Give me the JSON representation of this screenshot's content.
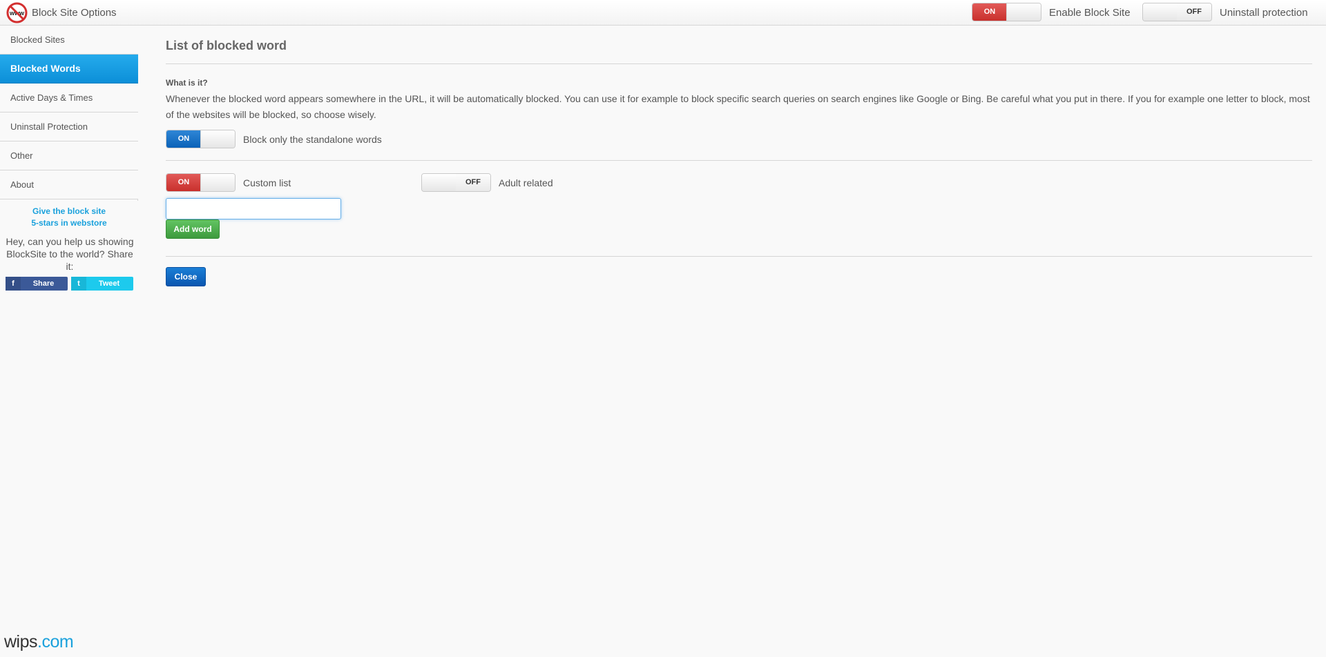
{
  "header": {
    "app_title": "Block Site Options",
    "enable_toggle": {
      "state_label": "ON",
      "label": "Enable Block Site"
    },
    "uninstall_toggle": {
      "state_label": "OFF",
      "label": "Uninstall protection"
    }
  },
  "sidebar": {
    "items": [
      {
        "label": "Blocked Sites"
      },
      {
        "label": "Blocked Words",
        "active": true
      },
      {
        "label": "Active Days & Times"
      },
      {
        "label": "Uninstall Protection"
      },
      {
        "label": "Other"
      },
      {
        "label": "About"
      }
    ],
    "promo_line1": "Give the block site",
    "promo_line2": "5-stars in webstore",
    "help_text": "Hey, can you help us showing BlockSite to the world? Share it:",
    "share_label": "Share",
    "tweet_label": "Tweet",
    "share_icon": "f",
    "tweet_icon": "t"
  },
  "main": {
    "title": "List of blocked word",
    "what_label": "What is it?",
    "description": "Whenever the blocked word appears somewhere in the URL, it will be automatically blocked. You can use it for example to block specific search queries on search engines like Google or Bing. Be careful what you put in there. If you for example one letter to block, most of the websites will be blocked, so choose wisely.",
    "standalone_toggle": {
      "state_label": "ON",
      "label": "Block only the standalone words"
    },
    "custom_toggle": {
      "state_label": "ON",
      "label": "Custom list"
    },
    "adult_toggle": {
      "state_label": "OFF",
      "label": "Adult related"
    },
    "word_input": {
      "value": "",
      "placeholder": ""
    },
    "add_word_label": "Add word",
    "close_label": "Close"
  },
  "footer": {
    "brand_part1": "wips",
    "brand_part2": ".com"
  },
  "colors": {
    "accent_blue": "#1aa1dc",
    "toggle_red": "#c9302c",
    "toggle_blue": "#0b62b8",
    "btn_green": "#3d9a3d"
  }
}
